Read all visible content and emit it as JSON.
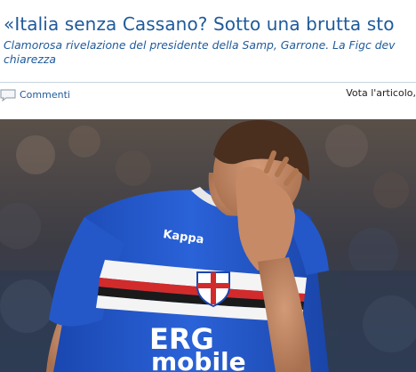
{
  "article": {
    "title": "«Italia senza Cassano? Sotto una brutta sto",
    "subtitle": "Clamorosa rivelazione del presidente della Samp, Garrone. La Figc dev chiarezza"
  },
  "toolbar": {
    "comments_label": "Commenti",
    "vote_label": "Vota l'articolo,"
  },
  "photo": {
    "shirt_brand": "Kappa",
    "sponsor_line1": "ERG",
    "sponsor_line2": "mobile"
  },
  "colors": {
    "title_blue": "#1f5a9a",
    "shirt_blue": "#1d4fc1",
    "divider": "#c7d3de"
  }
}
